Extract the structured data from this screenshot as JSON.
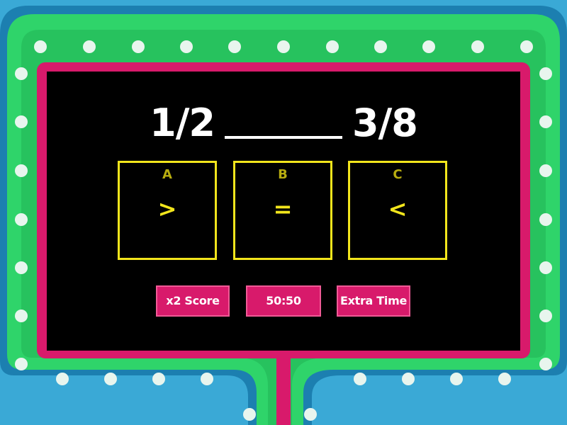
{
  "question": {
    "left": "1/2",
    "right": "3/8"
  },
  "answers": [
    {
      "letter": "A",
      "text": ">"
    },
    {
      "letter": "B",
      "text": "="
    },
    {
      "letter": "C",
      "text": "<"
    }
  ],
  "powerups": [
    {
      "label": "x2 Score"
    },
    {
      "label": "50:50"
    },
    {
      "label": "Extra Time"
    }
  ],
  "colors": {
    "background_blue": "#3aa9d6",
    "frame_green": "#2fd46a",
    "border_pink": "#d81a6b",
    "screen_black": "#000000",
    "answer_yellow": "#f2e51c",
    "bulb_white": "#e8f5ee"
  }
}
